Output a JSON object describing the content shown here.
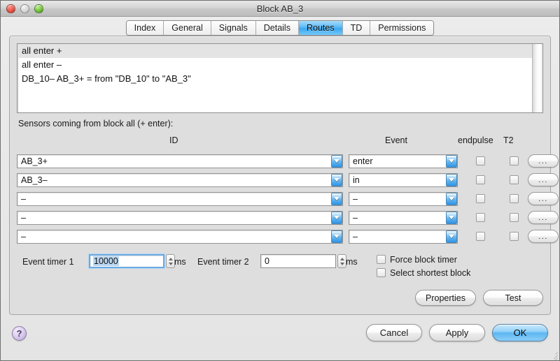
{
  "window": {
    "title": "Block AB_3",
    "controls": [
      {
        "name": "close-button",
        "label": ""
      },
      {
        "name": "minimize-button",
        "label": ""
      },
      {
        "name": "zoom-button",
        "label": ""
      }
    ]
  },
  "tabs": [
    {
      "label": "Index",
      "selected": false
    },
    {
      "label": "General",
      "selected": false
    },
    {
      "label": "Signals",
      "selected": false
    },
    {
      "label": "Details",
      "selected": false
    },
    {
      "label": "Routes",
      "selected": true
    },
    {
      "label": "TD",
      "selected": false
    },
    {
      "label": "Permissions",
      "selected": false
    }
  ],
  "routes_list": {
    "items": [
      "all enter +",
      "all enter –",
      "DB_10– AB_3+ = from \"DB_10\" to \"AB_3\""
    ]
  },
  "sensors": {
    "section_label": "Sensors coming from block all (+ enter):",
    "headers": {
      "id": "ID",
      "event": "Event",
      "endpulse": "endpulse",
      "t2": "T2"
    },
    "ellipsis_label": "...",
    "rows": [
      {
        "id": "AB_3+",
        "event": "enter",
        "endpulse": false,
        "t2": false
      },
      {
        "id": "AB_3–",
        "event": "in",
        "endpulse": false,
        "t2": false
      },
      {
        "id": "–",
        "event": "–",
        "endpulse": false,
        "t2": false
      },
      {
        "id": "–",
        "event": "–",
        "endpulse": false,
        "t2": false
      },
      {
        "id": "–",
        "event": "–",
        "endpulse": false,
        "t2": false
      }
    ]
  },
  "timers": {
    "timer1_label": "Event timer 1",
    "timer1_value": "10000",
    "timer1_unit": "ms",
    "timer2_label": "Event timer 2",
    "timer2_value": "0",
    "timer2_unit": "ms",
    "force_block_timer_label": "Force block timer",
    "force_block_timer_checked": false,
    "select_shortest_block_label": "Select shortest block",
    "select_shortest_block_checked": false
  },
  "panel_buttons": {
    "properties": "Properties",
    "test": "Test"
  },
  "footer": {
    "help": "?",
    "cancel": "Cancel",
    "apply": "Apply",
    "ok": "OK"
  },
  "colors": {
    "accent_blue": "#3aa8f2",
    "window_bg": "#e4e4e4",
    "panel_bg": "#dedede",
    "close_red": "#ec5f52",
    "zoom_green": "#7fcb44",
    "help_purple": "#b9a3d6"
  }
}
